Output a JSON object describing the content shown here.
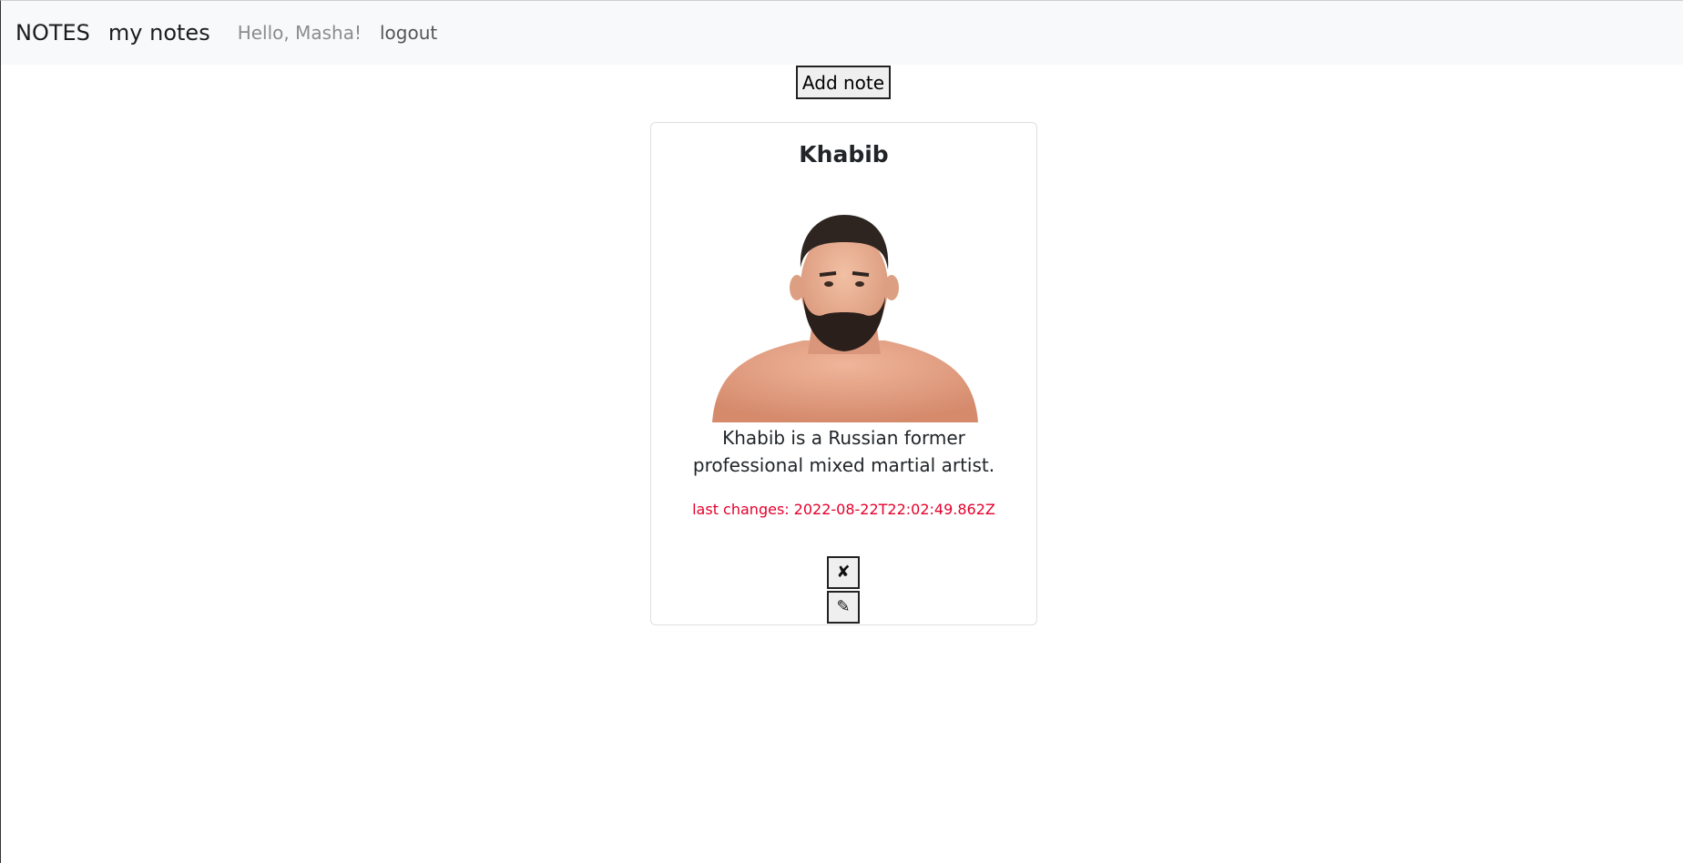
{
  "navbar": {
    "brand": "NOTES",
    "my_notes": "my notes",
    "greeting": "Hello, Masha!",
    "logout": "logout"
  },
  "toolbar": {
    "add_note_label": "Add note"
  },
  "notes": [
    {
      "title": "Khabib",
      "image_description": "portrait photo",
      "text": "Khabib is a Russian former professional mixed martial artist.",
      "last_changes_label": "last changes:",
      "last_changes_value": "2022-08-22T22:02:49.862Z",
      "delete_icon": "✘",
      "edit_icon": "✎"
    }
  ],
  "colors": {
    "navbar_bg": "#f8f9fa",
    "timestamp": "#e4002b",
    "greeting": "#8c8c8c"
  }
}
